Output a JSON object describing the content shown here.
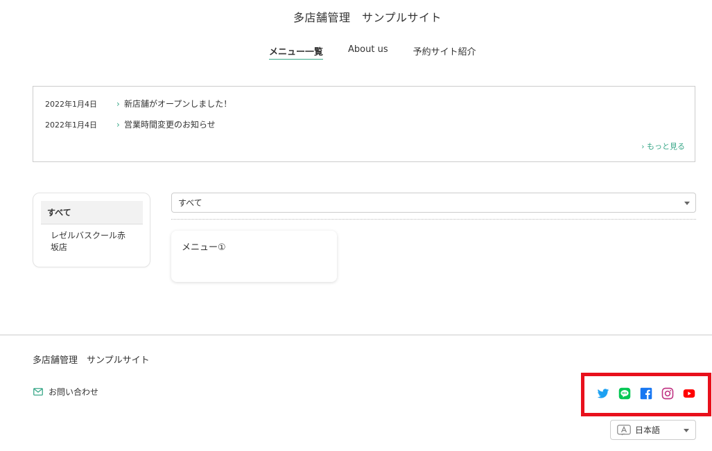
{
  "header": {
    "site_title": "多店舗管理　サンプルサイト",
    "nav": [
      {
        "label": "メニュー一覧",
        "active": true
      },
      {
        "label": "About us",
        "active": false
      },
      {
        "label": "予約サイト紹介",
        "active": false
      }
    ]
  },
  "news": {
    "items": [
      {
        "date": "2022年1月4日",
        "title": "新店舗がオープンしました！"
      },
      {
        "date": "2022年1月4日",
        "title": "営業時間変更のお知らせ"
      }
    ],
    "more_label": "もっと見る"
  },
  "categories": {
    "items": [
      {
        "label": "すべて",
        "selected": true
      },
      {
        "label": "レゼルバスクール赤坂店",
        "selected": false
      }
    ]
  },
  "filter": {
    "selected": "すべて"
  },
  "menu_cards": [
    {
      "title": "メニュー①"
    }
  ],
  "footer": {
    "site_title": "多店舗管理　サンプルサイト",
    "contact_label": "お問い合わせ",
    "social": [
      "twitter-icon",
      "line-icon",
      "facebook-icon",
      "instagram-icon",
      "youtube-icon"
    ],
    "language": "日本語"
  },
  "colors": {
    "accent": "#3aa889",
    "highlight_frame": "#e8101c",
    "twitter": "#1da1f2",
    "line": "#06c755",
    "facebook": "#1877f2",
    "instagram": "#c13584",
    "youtube": "#ff0000"
  }
}
